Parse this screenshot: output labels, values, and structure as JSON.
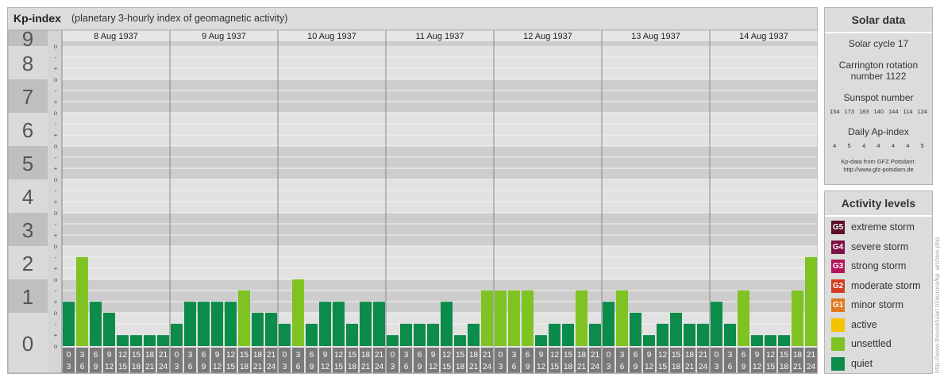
{
  "header": {
    "title": "Kp-index",
    "subtitle": "(planetary 3-hourly index of geomagnetic activity)"
  },
  "colors": {
    "quiet": "#0b8c4a",
    "unsettled": "#7fc323",
    "active": "#f5c400",
    "panel": "#dcdcdc"
  },
  "chart_data": {
    "type": "bar",
    "title": "Kp-index",
    "subtitle": "(planetary 3-hourly index of geomagnetic activity)",
    "ylim": [
      0,
      9
    ],
    "y_ticks": [
      "0",
      "1",
      "2",
      "3",
      "4",
      "5",
      "6",
      "7",
      "8",
      "9"
    ],
    "y_minor_ticks": [
      "o",
      "+",
      "-"
    ],
    "days": [
      "8 Aug 1937",
      "9 Aug 1937",
      "10 Aug 1937",
      "11 Aug 1937",
      "12 Aug 1937",
      "13 Aug 1937",
      "14 Aug 1937"
    ],
    "interval_labels": [
      [
        "0",
        "3"
      ],
      [
        "3",
        "6"
      ],
      [
        "6",
        "9"
      ],
      [
        "9",
        "12"
      ],
      [
        "12",
        "15"
      ],
      [
        "15",
        "18"
      ],
      [
        "18",
        "21"
      ],
      [
        "21",
        "24"
      ]
    ],
    "values": [
      [
        1.33,
        2.67,
        1.33,
        1.0,
        0.33,
        0.33,
        0.33,
        0.33
      ],
      [
        0.67,
        1.33,
        1.33,
        1.33,
        1.33,
        1.67,
        1.0,
        1.0
      ],
      [
        0.67,
        2.0,
        0.67,
        1.33,
        1.33,
        0.67,
        1.33,
        1.33
      ],
      [
        0.33,
        0.67,
        0.67,
        0.67,
        1.33,
        0.33,
        0.67,
        1.67
      ],
      [
        1.67,
        1.67,
        1.67,
        0.33,
        0.67,
        0.67,
        1.67,
        0.67
      ],
      [
        1.33,
        1.67,
        1.0,
        0.33,
        0.67,
        1.0,
        0.67,
        0.67
      ],
      [
        1.33,
        0.67,
        1.67,
        0.33,
        0.33,
        0.33,
        1.67,
        2.67
      ]
    ],
    "grid": true
  },
  "solar": {
    "title": "Solar data",
    "cycle": "Solar cycle 17",
    "carrington_1": "Carrington rotation",
    "carrington_2": "number 1122",
    "sunspot_title": "Sunspot number",
    "sunspots": [
      "154",
      "173",
      "183",
      "140",
      "144",
      "114",
      "124"
    ],
    "ap_title": "Daily Ap-index",
    "ap": [
      "4",
      "5",
      "4",
      "4",
      "4",
      "4",
      "5"
    ],
    "credit_1": "Kp-data from GFZ Potsdam:",
    "credit_2": "http://www.gfz-potsdam.de"
  },
  "activity": {
    "title": "Activity levels",
    "levels": [
      {
        "code": "G5",
        "label": "extreme storm",
        "color": "#5b0f2a"
      },
      {
        "code": "G4",
        "label": "severe storm",
        "color": "#7d1144"
      },
      {
        "code": "G3",
        "label": "strong storm",
        "color": "#b3145c"
      },
      {
        "code": "G2",
        "label": "moderate storm",
        "color": "#d23c1f"
      },
      {
        "code": "G1",
        "label": "minor storm",
        "color": "#e17a1f"
      },
      {
        "code": "",
        "label": "active",
        "color": "#f5c400"
      },
      {
        "code": "",
        "label": "unsettled",
        "color": "#7fc323"
      },
      {
        "code": "",
        "label": "quiet",
        "color": "#0b8c4a"
      }
    ]
  },
  "watermark": "http://www.theusefulart.nl/aurora/kp_archive.php"
}
